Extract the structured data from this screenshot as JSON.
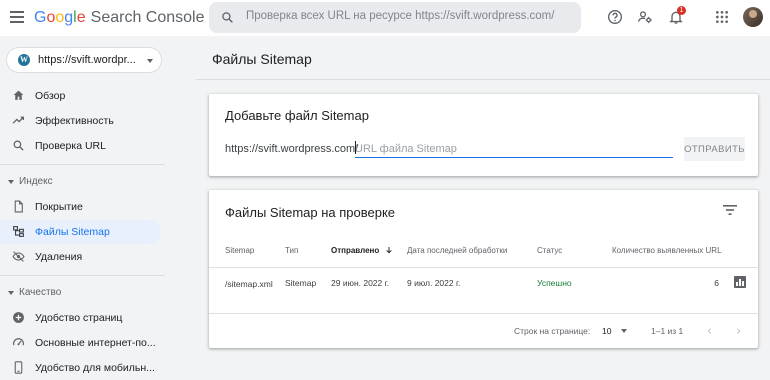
{
  "header": {
    "logo_google": [
      "G",
      "o",
      "o",
      "g",
      "l",
      "e"
    ],
    "logo_product": "Search Console",
    "search_placeholder": "Проверка всех URL на ресурсе https://svift.wordpress.com/",
    "notification_count": "1"
  },
  "sidebar": {
    "property": "https://svift.wordpr...",
    "items": [
      {
        "label": "Обзор",
        "icon": "home-icon"
      },
      {
        "label": "Эффективность",
        "icon": "trending-icon"
      },
      {
        "label": "Проверка URL",
        "icon": "search-icon"
      }
    ],
    "section_index": "Индекс",
    "index_items": [
      {
        "label": "Покрытие",
        "icon": "document-icon"
      },
      {
        "label": "Файлы Sitemap",
        "icon": "sitemap-icon",
        "active": true
      },
      {
        "label": "Удаления",
        "icon": "visibility-off-icon"
      }
    ],
    "section_quality": "Качество",
    "quality_items": [
      {
        "label": "Удобство страниц",
        "icon": "add-circle-icon"
      },
      {
        "label": "Основные интернет-по...",
        "icon": "speed-icon"
      },
      {
        "label": "Удобство для мобильн...",
        "icon": "phone-icon"
      }
    ]
  },
  "main": {
    "page_title": "Файлы Sitemap",
    "add_card": {
      "title": "Добавьте файл Sitemap",
      "prefix": "https://svift.wordpress.com/",
      "placeholder": "URL файла Sitemap",
      "submit": "ОТПРАВИТЬ"
    },
    "list_card": {
      "title": "Файлы Sitemap на проверке",
      "columns": [
        "Sitemap",
        "Тип",
        "Отправлено",
        "Дата последней обработки",
        "Статус",
        "Количество выявленных URL"
      ],
      "rows": [
        {
          "sitemap": "/sitemap.xml",
          "type": "Sitemap",
          "submitted": "29 июн. 2022 г.",
          "last_read": "9 июл. 2022 г.",
          "status": "Успешно",
          "urls": "6"
        }
      ],
      "pagination": {
        "rows_label": "Строк на странице:",
        "rows_value": "10",
        "range": "1–1 из 1"
      }
    }
  },
  "colors": {
    "accent": "#1a73e8",
    "active_bg": "#e8f0fe",
    "success": "#188038",
    "badge": "#d93025"
  }
}
